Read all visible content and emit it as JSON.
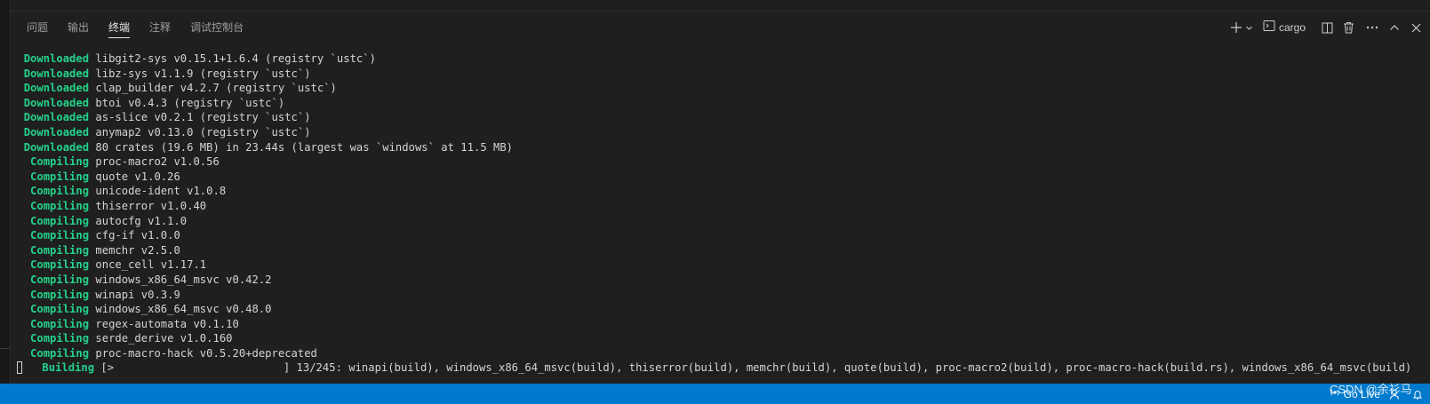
{
  "panel": {
    "tabs": [
      {
        "label": "问题",
        "active": false
      },
      {
        "label": "输出",
        "active": false
      },
      {
        "label": "终端",
        "active": true
      },
      {
        "label": "注释",
        "active": false
      },
      {
        "label": "调试控制台",
        "active": false
      }
    ],
    "actions": {
      "new_terminal_icon": "plus-icon",
      "dropdown_icon": "chevron-down-icon",
      "terminal_icon": "terminal-icon",
      "terminal_name": "cargo",
      "split_icon": "split-icon",
      "trash_icon": "trash-icon",
      "more_icon": "ellipsis-icon",
      "maximize_icon": "chevron-up-icon",
      "close_icon": "close-icon"
    }
  },
  "terminal": {
    "lines": [
      {
        "status": "Downloaded",
        "text": "libgit2-sys v0.15.1+1.6.4 (registry `ustc`)"
      },
      {
        "status": "Downloaded",
        "text": "libz-sys v1.1.9 (registry `ustc`)"
      },
      {
        "status": "Downloaded",
        "text": "clap_builder v4.2.7 (registry `ustc`)"
      },
      {
        "status": "Downloaded",
        "text": "btoi v0.4.3 (registry `ustc`)"
      },
      {
        "status": "Downloaded",
        "text": "as-slice v0.2.1 (registry `ustc`)"
      },
      {
        "status": "Downloaded",
        "text": "anymap2 v0.13.0 (registry `ustc`)"
      },
      {
        "status": "Downloaded",
        "text": "80 crates (19.6 MB) in 23.44s (largest was `windows` at 11.5 MB)"
      },
      {
        "status": " Compiling",
        "text": "proc-macro2 v1.0.56"
      },
      {
        "status": " Compiling",
        "text": "quote v1.0.26"
      },
      {
        "status": " Compiling",
        "text": "unicode-ident v1.0.8"
      },
      {
        "status": " Compiling",
        "text": "thiserror v1.0.40"
      },
      {
        "status": " Compiling",
        "text": "autocfg v1.1.0"
      },
      {
        "status": " Compiling",
        "text": "cfg-if v1.0.0"
      },
      {
        "status": " Compiling",
        "text": "memchr v2.5.0"
      },
      {
        "status": " Compiling",
        "text": "once_cell v1.17.1"
      },
      {
        "status": " Compiling",
        "text": "windows_x86_64_msvc v0.42.2"
      },
      {
        "status": " Compiling",
        "text": "winapi v0.3.9"
      },
      {
        "status": " Compiling",
        "text": "windows_x86_64_msvc v0.48.0"
      },
      {
        "status": " Compiling",
        "text": "regex-automata v0.1.10"
      },
      {
        "status": " Compiling",
        "text": "serde_derive v1.0.160"
      },
      {
        "status": " Compiling",
        "text": "proc-macro-hack v0.5.20+deprecated"
      }
    ],
    "progress": {
      "status": "Building",
      "bar": "[>                          ]",
      "text": "13/245: winapi(build), windows_x86_64_msvc(build), thiserror(build), memchr(build), quote(build), proc-macro2(build), proc-macro-hack(build.rs), windows_x86_64_msvc(build)",
      "done": 13,
      "total": 245
    }
  },
  "statusbar": {
    "go_live_icon": "broadcast-icon",
    "go_live": "Go Live",
    "bell_icon": "bell-icon"
  },
  "watermark": "CSDN @余衫马"
}
